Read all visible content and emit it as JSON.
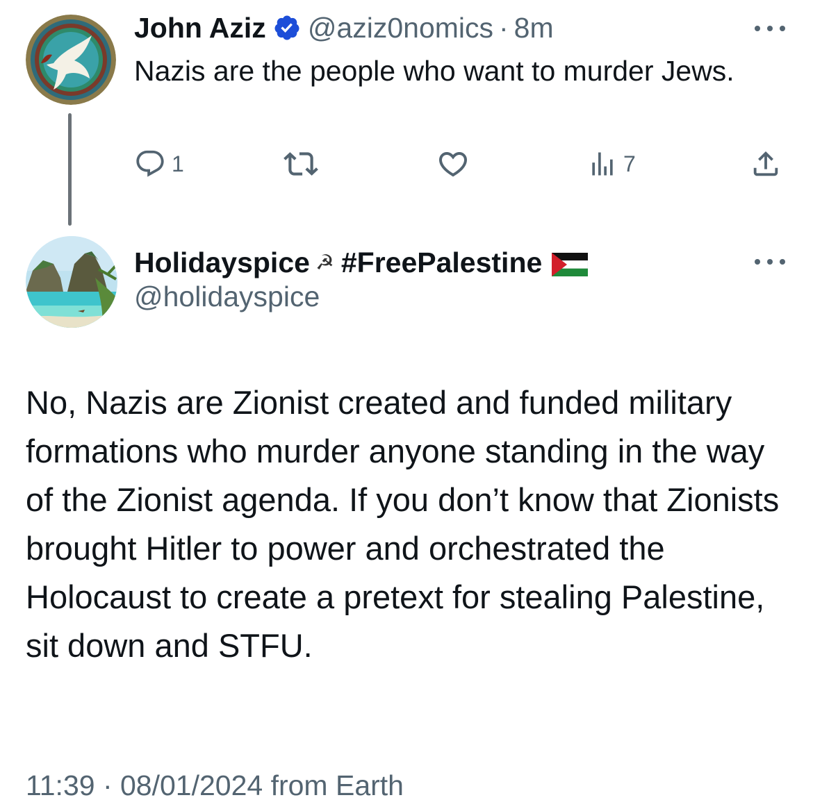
{
  "parent_tweet": {
    "author_name": "John Aziz",
    "handle": "@aziz0nomics",
    "separator": "·",
    "time": "8m",
    "text": "Nazis are the people who want to murder Jews.",
    "avatar_icon": "dove-icon",
    "verified_icon": "verified-badge-icon",
    "actions": {
      "reply_count": "1",
      "retweet_count": "",
      "like_count": "",
      "views_count": "7"
    }
  },
  "reply_tweet": {
    "author_name": "Holidayspice",
    "name_symbol": "☭",
    "name_hashtag": "#FreePalestine",
    "handle": "@holidayspice",
    "text": "No, Nazis are Zionist created and funded military formations who murder anyone standing in the way of the Zionist agenda. If you don’t know that Zionists brought Hitler to power and orchestrated the Holocaust to create a pretext for stealing Palestine, sit down and STFU.",
    "timestamp": "11:39 · 08/01/2024 from Earth",
    "avatar_icon": "beach-avatar-icon",
    "flag_icon": "palestine-flag-icon"
  },
  "colors": {
    "text_primary": "#0f1419",
    "text_secondary": "#536471",
    "verified_blue": "#1d9bf0",
    "thread_line": "#6b7278"
  }
}
